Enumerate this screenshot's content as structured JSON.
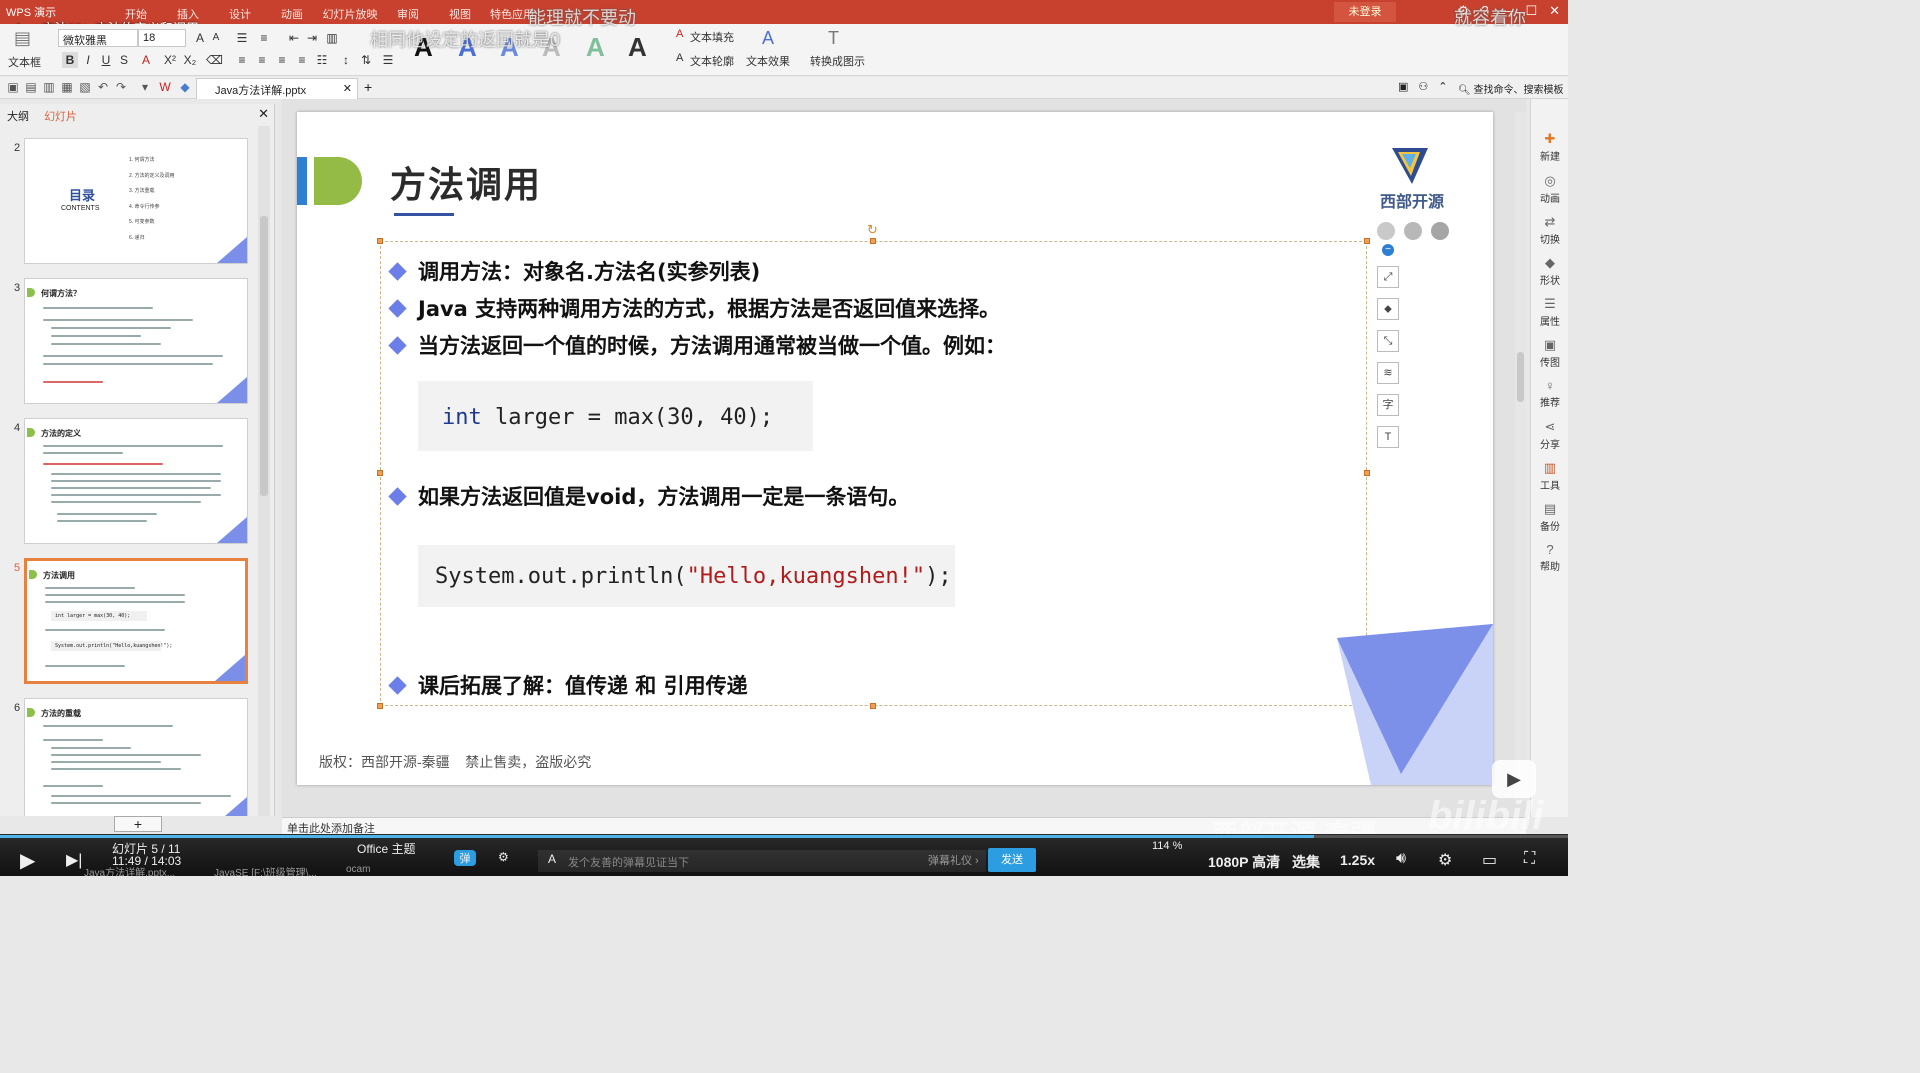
{
  "titlebar": {
    "app_name": "WPS 演示",
    "video_title": "Java方法02：方法的定义和调用",
    "menu": [
      "开始",
      "插入",
      "设计",
      "动画",
      "幻灯片放映",
      "审阅",
      "视图",
      "特色应用"
    ],
    "login": "未登录",
    "window_buttons": [
      "⚙",
      "?",
      "—",
      "☐",
      "✕"
    ]
  },
  "danmaku": [
    {
      "text": "能理就不要动"
    },
    {
      "text": "相同他设定的返回就是0"
    },
    {
      "text": "就容着你"
    }
  ],
  "ribbon": {
    "textbox_label": "文本框",
    "font_name": "微软雅黑",
    "font_size": "18",
    "text_fill": "文本填充",
    "text_outline": "文本轮廓",
    "text_effect": "文本效果",
    "convert_graphic": "转换成图示"
  },
  "quickbar": {
    "doc_tab": "Java方法详解.pptx",
    "search": "查找命令、搜索模板"
  },
  "left_panel": {
    "tab_outline": "大纲",
    "tab_slides": "幻灯片",
    "thumbnails": [
      {
        "num": "2",
        "title": "目录",
        "subtitle": "CONTENTS",
        "items": [
          "1. 何谓方法",
          "2. 方法的定义及调用",
          "3. 方法重载",
          "4. 命令行传参",
          "5. 可变参数",
          "6. 递归"
        ]
      },
      {
        "num": "3",
        "title": "何谓方法？"
      },
      {
        "num": "4",
        "title": "方法的定义"
      },
      {
        "num": "5",
        "title": "方法调用",
        "code1": "int larger = max(30, 40);",
        "code2": "System.out.println(\"Hello,kuangshen!\");"
      },
      {
        "num": "6",
        "title": "方法的重载"
      }
    ]
  },
  "slide": {
    "title": "方法调用",
    "logo_text": "西部开源",
    "bullets": [
      "调用方法：对象名.方法名(实参列表)",
      "Java 支持两种调用方法的方式，根据方法是否返回值来选择。",
      "当方法返回一个值的时候，方法调用通常被当做一个值。例如：",
      "如果方法返回值是void，方法调用一定是一条语句。",
      "课后拓展了解：值传递 和 引用传递"
    ],
    "code1": {
      "kw": "int",
      "rest": " larger = max(30, 40);"
    },
    "code2": {
      "pre": "System.out.println(",
      "str": "\"Hello,kuangshen!\"",
      "post": ");"
    },
    "copyright": "版权：西部开源-秦疆    禁止售卖，盗版必究"
  },
  "side_tools": [
    "⤢",
    "⬥",
    "⤡",
    "≋",
    "字",
    "T"
  ],
  "right_panel": [
    {
      "label": "新建",
      "icon": "✚"
    },
    {
      "label": "动画",
      "icon": "◎"
    },
    {
      "label": "切换",
      "icon": "⇄"
    },
    {
      "label": "形状",
      "icon": "◆"
    },
    {
      "label": "属性",
      "icon": "☰"
    },
    {
      "label": "传图",
      "icon": "▣"
    },
    {
      "label": "推荐",
      "icon": "♀"
    },
    {
      "label": "分享",
      "icon": "⋖"
    },
    {
      "label": "工具",
      "icon": "▥"
    },
    {
      "label": "备份",
      "icon": "▤"
    },
    {
      "label": "帮助",
      "icon": "?"
    }
  ],
  "notes_placeholder": "单击此处添加备注",
  "status": {
    "slide_index": "幻灯片 5 / 11",
    "theme": "Office 主题",
    "zoom": "114 %"
  },
  "player": {
    "time": "11:49 / 14:03",
    "danmaku_placeholder": "发个友善的弹幕见证当下",
    "etiquette": "弹幕礼仪 ›",
    "send": "发送",
    "quality": "1080P 高清",
    "episodes": "选集",
    "speed": "1.25x",
    "progress_fraction": 0.838,
    "taskbar": [
      "Java方法详解.pptx...",
      "JavaSE [F:\\班级管理\\...",
      "ocam"
    ]
  },
  "watermark": {
    "text1": "西部开源-秦疆",
    "text2": "bilibili"
  }
}
